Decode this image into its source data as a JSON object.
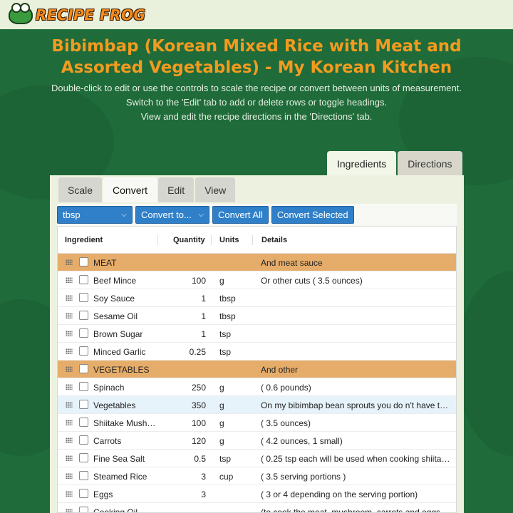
{
  "brand": {
    "name": "RECIPE FROG"
  },
  "title": "Bibimbap (Korean Mixed Rice with Meat and Assorted Vegetables) - My Korean Kitchen",
  "instructions": [
    "Double-click to edit or use the controls to scale the recipe or convert between units of measurement.",
    "Switch to the 'Edit' tab to add or delete rows or toggle headings.",
    "View and edit the recipe directions in the 'Directions' tab."
  ],
  "main_tabs": {
    "ingredients": "Ingredients",
    "directions": "Directions"
  },
  "sub_tabs": {
    "scale": "Scale",
    "convert": "Convert",
    "edit": "Edit",
    "view": "View"
  },
  "toolbar": {
    "unit_select": "tbsp",
    "convert_to_select": "Convert to...",
    "convert_all": "Convert All",
    "convert_selected": "Convert Selected"
  },
  "columns": {
    "ingredient": "Ingredient",
    "quantity": "Quantity",
    "units": "Units",
    "details": "Details"
  },
  "rows": [
    {
      "name": "MEAT",
      "qty": "",
      "units": "",
      "details": "And meat sauce",
      "heading": true
    },
    {
      "name": "Beef Mince",
      "qty": "100",
      "units": "g",
      "details": "Or other cuts ( 3.5 ounces)"
    },
    {
      "name": "Soy Sauce",
      "qty": "1",
      "units": "tbsp",
      "details": ""
    },
    {
      "name": "Sesame Oil",
      "qty": "1",
      "units": "tbsp",
      "details": ""
    },
    {
      "name": "Brown Sugar",
      "qty": "1",
      "units": "tsp",
      "details": ""
    },
    {
      "name": "Minced Garlic",
      "qty": "0.25",
      "units": "tsp",
      "details": ""
    },
    {
      "name": "VEGETABLES",
      "qty": "",
      "units": "",
      "details": "And other",
      "heading": true
    },
    {
      "name": "Spinach",
      "qty": "250",
      "units": "g",
      "details": "( 0.6 pounds)"
    },
    {
      "name": "Vegetables",
      "qty": "350",
      "units": "g",
      "details": "On my bibimbap bean sprouts you do n't have to...",
      "hover": true
    },
    {
      "name": "Shiitake Mushr...",
      "qty": "100",
      "units": "g",
      "details": "( 3.5 ounces)"
    },
    {
      "name": "Carrots",
      "qty": "120",
      "units": "g",
      "details": "( 4.2 ounces, 1 small)"
    },
    {
      "name": "Fine Sea Salt",
      "qty": "0.5",
      "units": "tsp",
      "details": "( 0.25 tsp each will be used when cooking shiitak..."
    },
    {
      "name": "Steamed Rice",
      "qty": "3",
      "units": "cup",
      "details": "( 3.5 serving portions )"
    },
    {
      "name": "Eggs",
      "qty": "3",
      "units": "",
      "details": "( 3 or 4 depending on the serving portion)"
    },
    {
      "name": "Cooking Oil",
      "qty": "",
      "units": "",
      "details": "(to cook the meat, mushroom, carrots and eggs -..."
    }
  ]
}
